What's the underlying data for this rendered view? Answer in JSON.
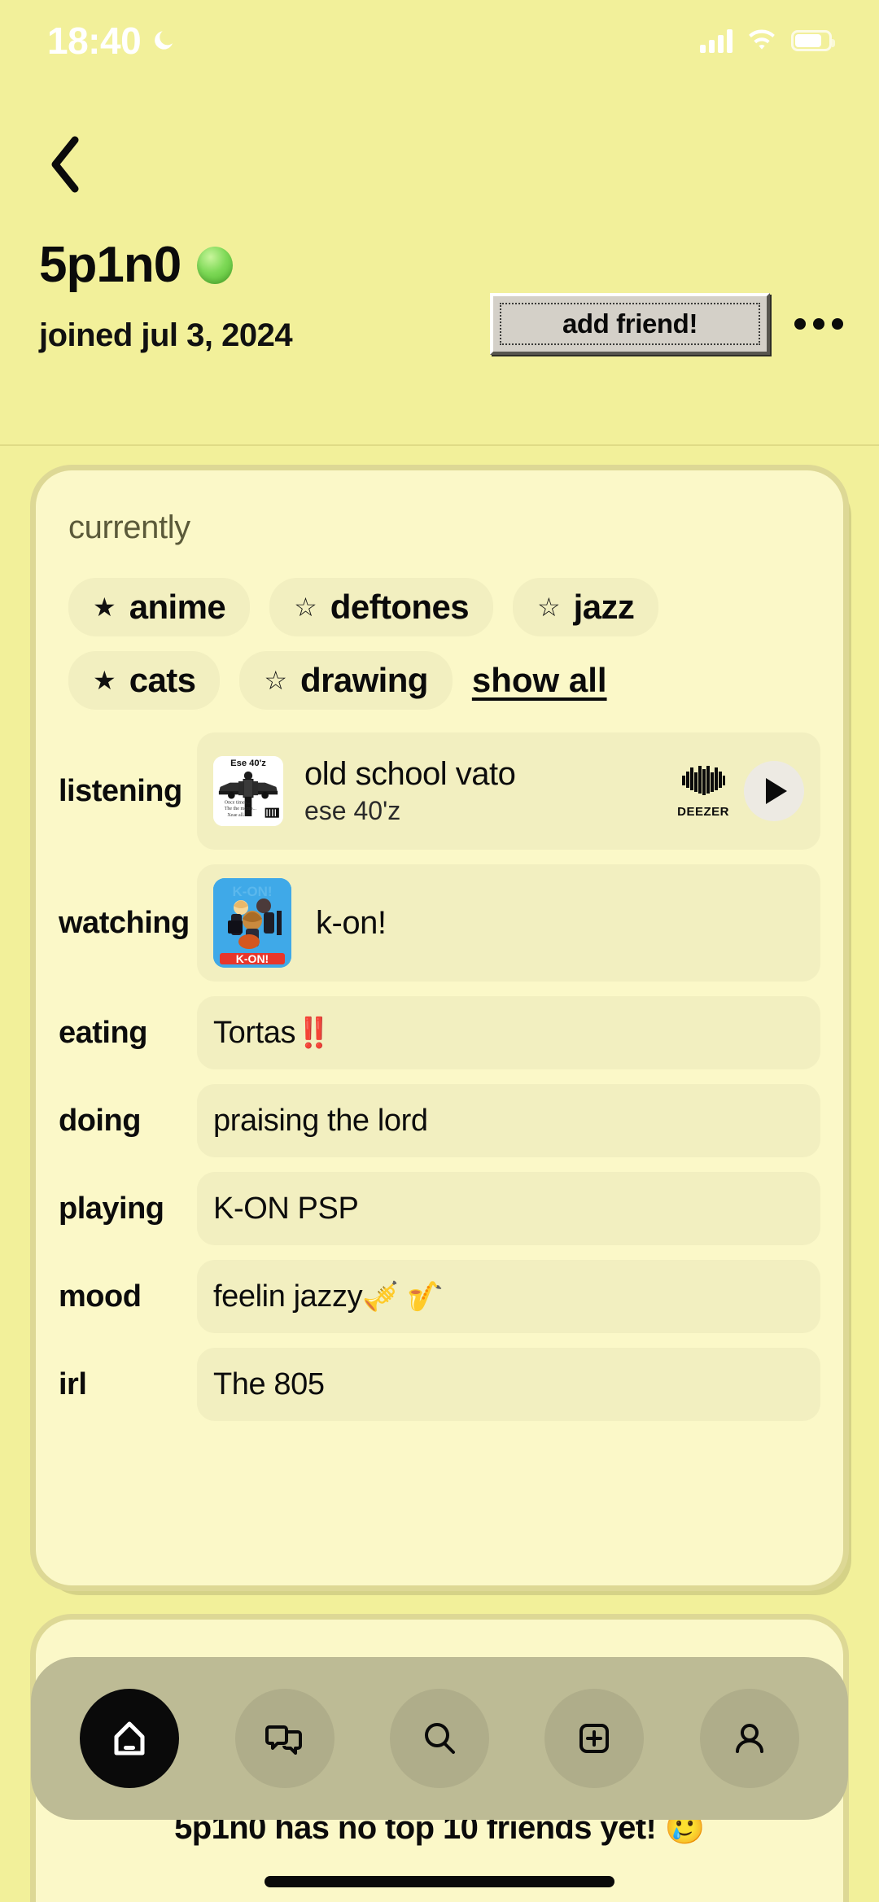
{
  "status_bar": {
    "time": "18:40",
    "moon_icon": "crescent-moon-icon",
    "signal_icon": "cellular-signal-icon",
    "wifi_icon": "wifi-icon",
    "battery_icon": "battery-icon"
  },
  "header": {
    "back_icon": "chevron-left-icon",
    "username": "5p1n0",
    "online_status_icon": "green-online-dot",
    "joined": "joined jul 3, 2024",
    "add_friend_label": "add friend!",
    "more_icon": "ellipsis-icon"
  },
  "currently": {
    "title": "currently",
    "tags": [
      {
        "star": "★",
        "label": "anime",
        "starred": true
      },
      {
        "star": "☆",
        "label": "deftones",
        "starred": false
      },
      {
        "star": "☆",
        "label": "jazz",
        "starred": false
      },
      {
        "star": "★",
        "label": "cats",
        "starred": true
      },
      {
        "star": "☆",
        "label": "drawing",
        "starred": false
      }
    ],
    "show_all_label": "show all",
    "listening": {
      "label": "listening",
      "track": "old school vato",
      "artist": "ese 40'z",
      "album_art_title": "Ese 40'z",
      "provider": "DEEZER",
      "provider_icon": "deezer-heart-icon",
      "play_icon": "play-icon"
    },
    "watching": {
      "label": "watching",
      "value": "k-on!",
      "art_title": "K-ON!"
    },
    "eating": {
      "label": "eating",
      "value": "Tortas ",
      "emoji": "‼️"
    },
    "doing": {
      "label": "doing",
      "value": "praising the lord",
      "emoji": ""
    },
    "playing": {
      "label": "playing",
      "value": "K-ON PSP",
      "emoji": ""
    },
    "mood": {
      "label": "mood",
      "value": "feelin jazzy ",
      "emoji": "🎺 🎷"
    },
    "irl": {
      "label": "irl",
      "value": "The 805",
      "emoji": ""
    }
  },
  "friends": {
    "empty_message": "5p1n0 has no top 10 friends yet! 🥲"
  },
  "navbar": {
    "items": [
      {
        "name": "home",
        "icon": "home-icon",
        "active": true
      },
      {
        "name": "chats",
        "icon": "chat-bubbles-icon",
        "active": false
      },
      {
        "name": "search",
        "icon": "search-icon",
        "active": false
      },
      {
        "name": "create",
        "icon": "plus-square-icon",
        "active": false
      },
      {
        "name": "profile",
        "icon": "person-icon",
        "active": false
      }
    ]
  },
  "colors": {
    "page_bg": "#F2F09A",
    "card_bg": "#FBF8C8",
    "pill_bg": "#F2EFC0",
    "navbar_bg": "#BDBB95",
    "accent_online": "#7ED957",
    "text": "#0B0B0B"
  }
}
